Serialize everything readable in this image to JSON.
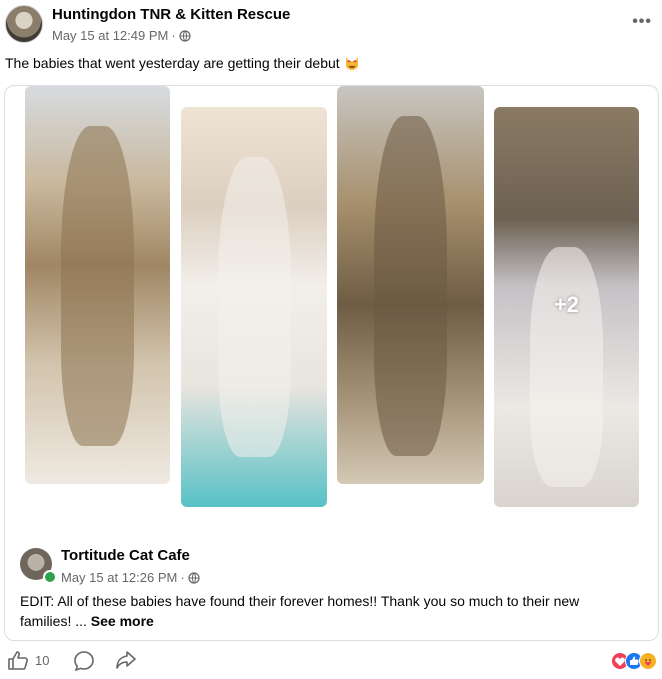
{
  "post": {
    "page_name": "Huntingdon TNR & Kitten Rescue",
    "timestamp": "May 15 at 12:49 PM",
    "separator": "·",
    "caption": "The babies that went yesterday are getting their debut"
  },
  "gallery": {
    "extra_count": "+2"
  },
  "shared_post": {
    "author": "Tortitude Cat Cafe",
    "timestamp": "May 15 at 12:26 PM",
    "separator": "·",
    "text": "EDIT: All of these babies have found their forever homes!! Thank you so much to their new families! ...",
    "see_more": "See more"
  },
  "footer": {
    "like_count": "10"
  },
  "colors": {
    "online": "#31a24c",
    "love": "#f33e58",
    "like": "#1877f2",
    "care": "#f7b125"
  },
  "icons": [
    "globe-icon",
    "more-icon",
    "like-icon",
    "comment-icon",
    "share-icon",
    "love-reaction-icon",
    "like-reaction-icon",
    "care-reaction-icon",
    "cat-emoji-icon"
  ]
}
